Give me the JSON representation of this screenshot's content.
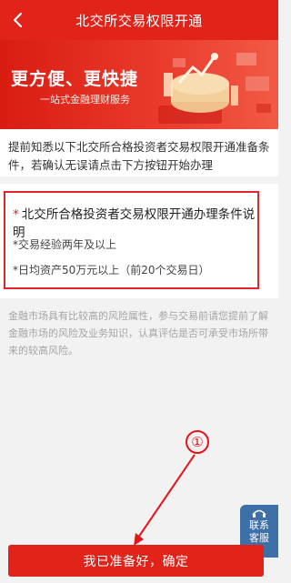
{
  "header": {
    "title": "北交所交易权限开通",
    "back_icon": "chevron-left-icon"
  },
  "banner": {
    "title": "更方便、更快捷",
    "subtitle": "一站式金融理财服务"
  },
  "intro": {
    "text": "提前知悉以下北交所合格投资者交易权限开通准备条件，若确认无误请点击下方按钮开始办理"
  },
  "conditions": {
    "star": "*",
    "title": "北交所合格投资者交易权限开通办理条件说明",
    "items": [
      "*交易经验两年及以上",
      "*日均资产50万元以上（前20个交易日）"
    ]
  },
  "risk_note": "金融市场具有比较高的风险属性，参与交易前请您提前了解金融市场的风险及业务知识，认真评估是否可承受市场所带来的较高风险。",
  "annotation": {
    "label": "①",
    "color": "#e3141b"
  },
  "service": {
    "line1": "联系",
    "line2": "客服"
  },
  "confirm_button": {
    "label": "我已准备好，确定"
  },
  "colors": {
    "brand_red": "#e2231a",
    "service_blue": "#3d6fa8"
  }
}
